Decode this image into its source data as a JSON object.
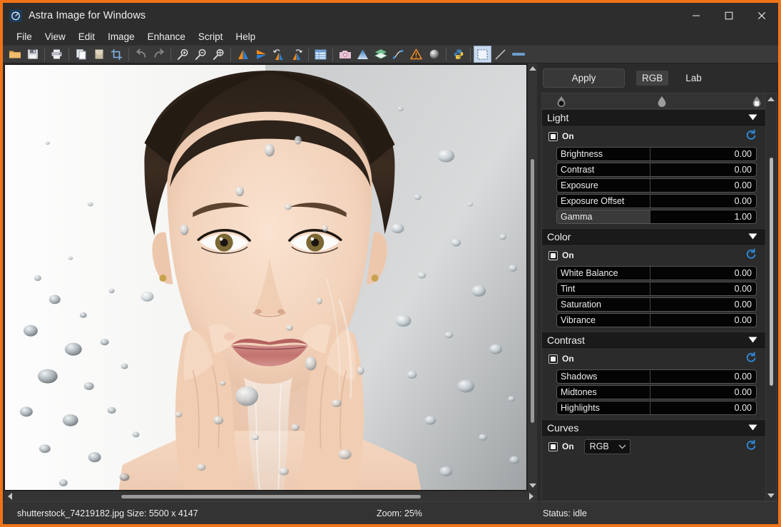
{
  "window": {
    "title": "Astra Image for Windows",
    "icon": "app-logo-icon",
    "controls": {
      "minimize": "minimize-icon",
      "maximize": "maximize-icon",
      "close": "close-icon"
    },
    "accent_border": "#f07318"
  },
  "menubar": {
    "items": [
      {
        "label": "File"
      },
      {
        "label": "View"
      },
      {
        "label": "Edit"
      },
      {
        "label": "Image"
      },
      {
        "label": "Enhance"
      },
      {
        "label": "Script"
      },
      {
        "label": "Help"
      }
    ]
  },
  "toolbar": {
    "groups": [
      {
        "buttons": [
          {
            "name": "open-file-icon",
            "title": "Open"
          },
          {
            "name": "save-file-icon",
            "title": "Save"
          }
        ]
      },
      {
        "buttons": [
          {
            "name": "print-icon",
            "title": "Print"
          }
        ]
      },
      {
        "buttons": [
          {
            "name": "copy-icon",
            "title": "Copy"
          },
          {
            "name": "paste-icon",
            "title": "Paste"
          },
          {
            "name": "crop-icon",
            "title": "Crop"
          }
        ]
      },
      {
        "buttons": [
          {
            "name": "undo-icon",
            "title": "Undo"
          },
          {
            "name": "redo-icon",
            "title": "Redo"
          }
        ]
      },
      {
        "buttons": [
          {
            "name": "zoom-in-icon",
            "title": "Zoom In"
          },
          {
            "name": "zoom-out-icon",
            "title": "Zoom Out"
          },
          {
            "name": "zoom-fit-icon",
            "title": "Zoom Fit"
          }
        ]
      },
      {
        "buttons": [
          {
            "name": "flip-horizontal-icon",
            "title": "Flip Horizontal"
          },
          {
            "name": "flip-vertical-icon",
            "title": "Flip Vertical"
          },
          {
            "name": "rotate-left-icon",
            "title": "Rotate Left"
          },
          {
            "name": "rotate-right-icon",
            "title": "Rotate Right"
          }
        ]
      },
      {
        "buttons": [
          {
            "name": "table-icon",
            "title": "Table"
          }
        ]
      },
      {
        "buttons": [
          {
            "name": "camera-icon",
            "title": "Capture"
          },
          {
            "name": "gradient-icon",
            "title": "Gradient"
          },
          {
            "name": "layers-icon",
            "title": "Layers"
          },
          {
            "name": "curve-icon",
            "title": "Curve"
          },
          {
            "name": "warning-icon",
            "title": "Warning"
          },
          {
            "name": "sphere-icon",
            "title": "Deconvolution"
          }
        ]
      },
      {
        "buttons": [
          {
            "name": "python-icon",
            "title": "Python Script"
          }
        ]
      },
      {
        "buttons": [
          {
            "name": "selection-rect-icon",
            "title": "Rectangle Selection",
            "active": true
          },
          {
            "name": "line-tool-icon",
            "title": "Line"
          },
          {
            "name": "bar-tool-icon",
            "title": "Bar"
          }
        ]
      }
    ]
  },
  "image_pane": {
    "alt": "Portrait of a woman splashing water on her face",
    "hscroll": {
      "left_arrow": "scroll-left-icon",
      "right_arrow": "scroll-right-icon"
    },
    "vscroll": {
      "up_arrow": "scroll-up-icon",
      "down_arrow": "scroll-down-icon"
    }
  },
  "panel": {
    "apply_label": "Apply",
    "modes": [
      {
        "label": "RGB",
        "selected": true
      },
      {
        "label": "Lab",
        "selected": false
      }
    ],
    "pickers": [
      {
        "name": "black-point-picker",
        "fill": "#141414"
      },
      {
        "name": "mid-point-picker",
        "fill": "#9a9a9a"
      },
      {
        "name": "white-point-picker",
        "fill": "#f2f2f2"
      }
    ],
    "sections": [
      {
        "title": "Light",
        "on_label": "On",
        "checked": true,
        "collapse_icon": "chevron-down-icon",
        "reset_icon": "reset-icon",
        "sliders": [
          {
            "label": "Brightness",
            "value": "0.00",
            "fill": 0
          },
          {
            "label": "Contrast",
            "value": "0.00",
            "fill": 0
          },
          {
            "label": "Exposure",
            "value": "0.00",
            "fill": 0
          },
          {
            "label": "Exposure Offset",
            "value": "0.00",
            "fill": 0
          },
          {
            "label": "Gamma",
            "value": "1.00",
            "fill": 1
          }
        ]
      },
      {
        "title": "Color",
        "on_label": "On",
        "checked": true,
        "collapse_icon": "chevron-down-icon",
        "reset_icon": "reset-icon",
        "sliders": [
          {
            "label": "White Balance",
            "value": "0.00",
            "fill": 0
          },
          {
            "label": "Tint",
            "value": "0.00",
            "fill": 0
          },
          {
            "label": "Saturation",
            "value": "0.00",
            "fill": 0
          },
          {
            "label": "Vibrance",
            "value": "0.00",
            "fill": 0
          }
        ]
      },
      {
        "title": "Contrast",
        "on_label": "On",
        "checked": true,
        "collapse_icon": "chevron-down-icon",
        "reset_icon": "reset-icon",
        "sliders": [
          {
            "label": "Shadows",
            "value": "0.00",
            "fill": 0
          },
          {
            "label": "Midtones",
            "value": "0.00",
            "fill": 0
          },
          {
            "label": "Highlights",
            "value": "0.00",
            "fill": 0
          }
        ]
      },
      {
        "title": "Curves",
        "on_label": "On",
        "checked": true,
        "collapse_icon": "chevron-down-icon",
        "reset_icon": "reset-icon",
        "channel": {
          "selected": "RGB",
          "chevron": "chevron-down-icon"
        },
        "sliders": []
      }
    ]
  },
  "statusbar": {
    "file_info": "shutterstock_74219182.jpg Size: 5500 x 4147",
    "zoom": "Zoom: 25%",
    "status": "Status: idle"
  }
}
